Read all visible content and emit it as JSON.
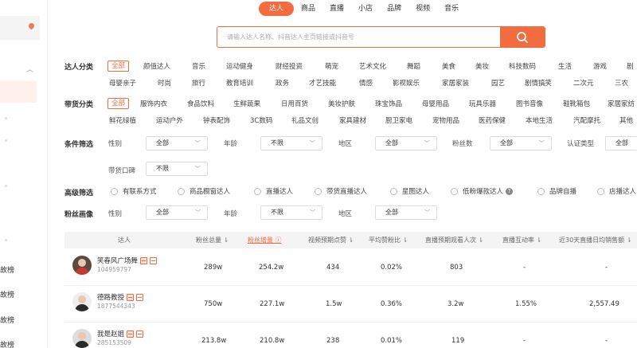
{
  "sidebar": {
    "rank_items": [
      "故榜",
      "故榜",
      "故榜",
      "故榜"
    ]
  },
  "tabs": [
    {
      "label": "达人",
      "active": true
    },
    {
      "label": "商品",
      "active": false
    },
    {
      "label": "直播",
      "active": false
    },
    {
      "label": "小店",
      "active": false
    },
    {
      "label": "品牌",
      "active": false
    },
    {
      "label": "视频",
      "active": false
    },
    {
      "label": "音乐",
      "active": false
    }
  ],
  "search": {
    "placeholder": "请输入达人名称、抖音达人主页链接或抖音号",
    "icon": "search-icon"
  },
  "filters": {
    "talent_category": {
      "label": "达人分类",
      "row1": [
        "全部",
        "颜值达人",
        "音乐",
        "运动健身",
        "财经投资",
        "萌宠",
        "艺术文化",
        "舞蹈",
        "美食",
        "美妆",
        "科技数码",
        "生活",
        "游戏",
        "剧"
      ],
      "row2": [
        "母婴亲子",
        "时尚",
        "旅行",
        "教育培训",
        "政务",
        "才艺技能",
        "情感",
        "影视娱乐",
        "家居家装",
        "园艺",
        "剧情搞笑",
        "二次元",
        "三农"
      ]
    },
    "goods_category": {
      "label": "带货分类",
      "row1": [
        "全部",
        "服饰内衣",
        "食品饮料",
        "生鲜蔬果",
        "日用百货",
        "美妆护肤",
        "珠宝饰品",
        "母婴用品",
        "玩具乐器",
        "图书音像",
        "鞋靴箱包",
        "家居家纺"
      ],
      "row2": [
        "鲜花绿植",
        "运动户外",
        "钟表配饰",
        "3C数码",
        "礼品文创",
        "家具建材",
        "厨卫家电",
        "宠物用品",
        "医药保健",
        "本地生活",
        "汽配摩托",
        "其他"
      ]
    },
    "conditions": {
      "label": "条件筛选",
      "gender_label": "性别",
      "gender_value": "全部",
      "age_label": "年龄",
      "age_value": "不限",
      "region_label": "地区",
      "region_value": "全部",
      "fans_label": "粉丝数",
      "fans_value": "全部",
      "verify_label": "认证类型",
      "verify_value": "全部",
      "reputation_label": "带货口碑",
      "reputation_value": "不限"
    },
    "advanced": {
      "label": "高级筛选",
      "options": [
        "有联系方式",
        "商品橱窗达人",
        "直播达人",
        "带货直播达人",
        "星图达人",
        "低粉爆款达人",
        "品牌自播",
        "店播达人"
      ]
    },
    "fan_profile": {
      "label": "粉丝画像",
      "gender_label": "性别",
      "gender_value": "全部",
      "age_label": "年龄",
      "age_value": "不限",
      "region_label": "地区",
      "region_value": "全部"
    }
  },
  "table": {
    "headers": [
      "达人",
      "粉丝总量",
      "粉丝增量",
      "视频预期点赞",
      "平均赞粉比",
      "直播预期观看人次",
      "直播互动率",
      "近30天直播日均销售额"
    ],
    "rows": [
      {
        "name": "笑春风广场舞",
        "id": "104959797",
        "fans": "289w",
        "growth": "254.2w",
        "likes": "434",
        "ratio": "0.02%",
        "viewers": "803",
        "interaction": "-",
        "sales": "-"
      },
      {
        "name": "德路教授",
        "id": "1877544343",
        "fans": "750w",
        "growth": "227.1w",
        "likes": "1.5w",
        "ratio": "0.36%",
        "viewers": "3.2w",
        "interaction": "1.55%",
        "sales": "2,557.49"
      },
      {
        "name": "我是赵姐",
        "id": "285153509",
        "fans": "213.8w",
        "growth": "210.8w",
        "likes": "238",
        "ratio": "0.01%",
        "viewers": "119",
        "interaction": "-",
        "sales": "-"
      }
    ]
  },
  "colors": {
    "accent": "#f36c3f"
  }
}
